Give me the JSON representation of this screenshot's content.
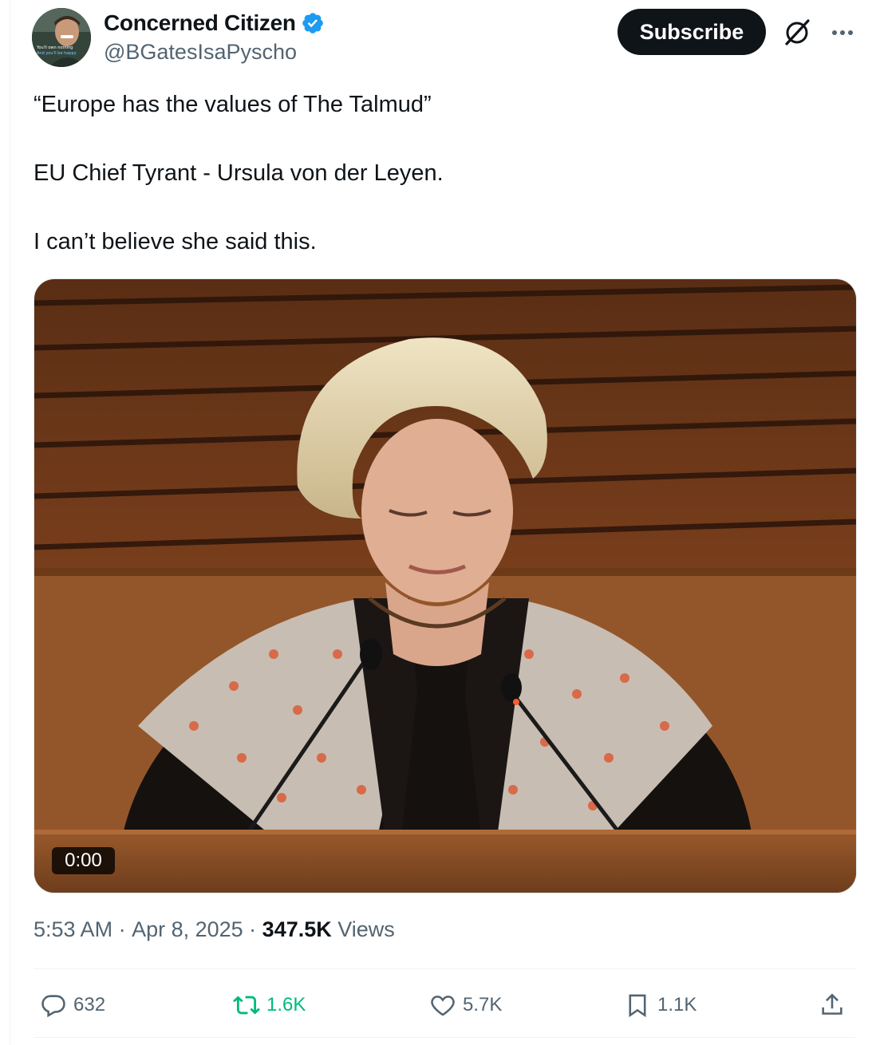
{
  "author": {
    "display_name": "Concerned Citizen",
    "handle": "@BGatesIsaPyscho",
    "verified": true,
    "avatar_caption_1": "You'll own nothing",
    "avatar_caption_2": "And you'll be happy"
  },
  "header": {
    "subscribe_label": "Subscribe",
    "grok_icon": "grok-icon",
    "more_icon": "more-icon"
  },
  "tweet": {
    "lines": [
      "“Europe has the values of The Talmud”",
      "EU Chief Tyrant - Ursula von der Leyen.",
      "I can’t believe she said this."
    ]
  },
  "media": {
    "type": "video",
    "timestamp": "0:00"
  },
  "meta": {
    "time": "5:53 AM",
    "sep": " · ",
    "date": "Apr 8, 2025",
    "views_count": "347.5K",
    "views_label": " Views"
  },
  "actions": {
    "replies": "632",
    "reposts": "1.6K",
    "likes": "5.7K",
    "bookmarks": "1.1K"
  },
  "colors": {
    "text": "#0f1419",
    "secondary": "#536471",
    "verified": "#1d9bf0",
    "repost_active": "#00ba7c"
  }
}
